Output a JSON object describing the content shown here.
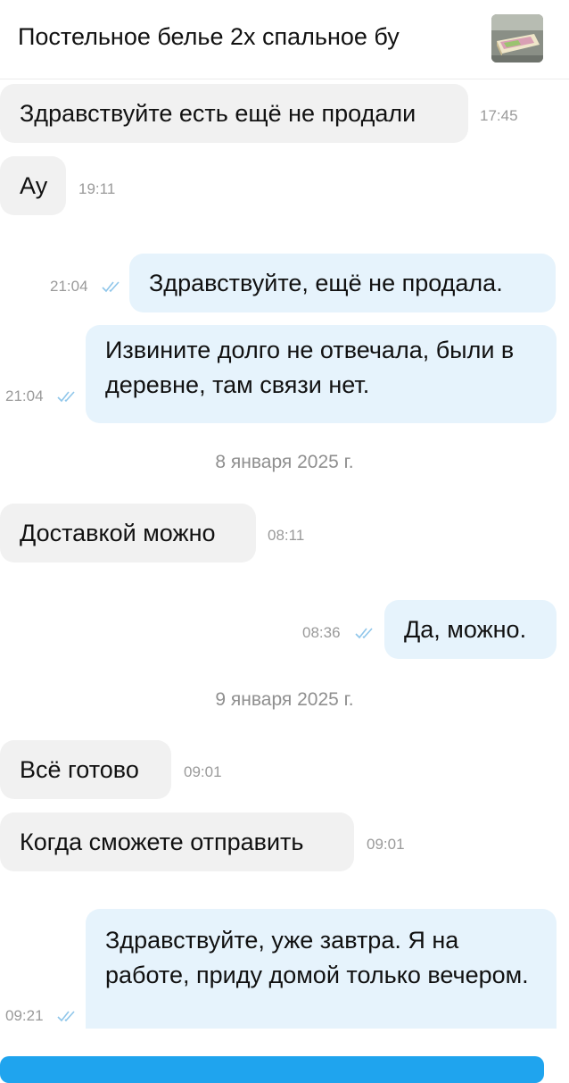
{
  "header": {
    "title": "Постельное белье 2х спальное бу",
    "thumbnail_icon": "bedding-photo-thumbnail"
  },
  "messages": [
    {
      "dir": "in",
      "text": "Здравствуйте есть ещё не продали",
      "time": "17:45"
    },
    {
      "dir": "in",
      "text": "Ау",
      "time": "19:11"
    },
    {
      "dir": "out",
      "text": "Здравствуйте,  ещё не продала.",
      "time": "21:04",
      "read": true
    },
    {
      "dir": "out",
      "text": "Извините долго не отвечала, были в деревне,  там связи нет.",
      "time": "21:04",
      "read": true
    },
    {
      "dir": "in",
      "text": "Доставкой можно",
      "time": "08:11"
    },
    {
      "dir": "out",
      "text": "Да, можно.",
      "time": "08:36",
      "read": true
    },
    {
      "dir": "in",
      "text": "Всё готово",
      "time": "09:01"
    },
    {
      "dir": "in",
      "text": "Когда сможете отправить",
      "time": "09:01"
    },
    {
      "dir": "out",
      "text": "Здравствуйте,  уже завтра. Я на работе, приду домой только вечером.",
      "time": "09:21",
      "read": true
    }
  ],
  "dates": [
    "8 января 2025 г.",
    "9 января 2025 г."
  ],
  "colors": {
    "incoming_bubble": "#f1f1f1",
    "outgoing_bubble": "#e6f3fc",
    "read_tick": "#8fc6ea",
    "accent": "#1fa4ee"
  }
}
